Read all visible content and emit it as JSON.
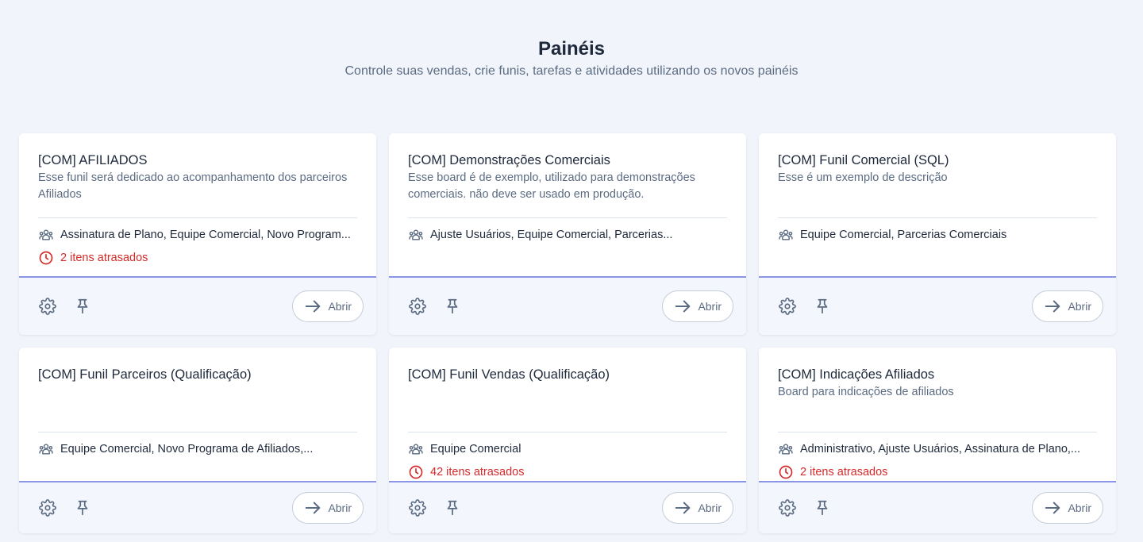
{
  "header": {
    "title": "Painéis",
    "subtitle": "Controle suas vendas, crie funis, tarefas e atividades utilizando os novos painéis"
  },
  "colors": {
    "accent": "#8b95e5",
    "overdue": "#d42a2a",
    "background": "#f1f5fb"
  },
  "icons": [
    "team-icon",
    "clock-icon",
    "gear-icon",
    "pin-icon",
    "arrow-right-icon"
  ],
  "open_label": "Abrir",
  "cards": [
    {
      "title": "[COM] AFILIADOS",
      "description": "Esse funil será dedicado ao acompanhamento dos parceiros Afiliados",
      "teams": "Assinatura de Plano, Equipe Comercial, Novo Program...",
      "overdue": "2 itens atrasados"
    },
    {
      "title": "[COM] Demonstrações Comerciais",
      "description": "Esse board é de exemplo, utilizado para demonstrações comerciais. não deve ser usado em produção.",
      "teams": "Ajuste Usuários, Equipe Comercial, Parcerias...",
      "overdue": ""
    },
    {
      "title": "[COM] Funil Comercial (SQL)",
      "description": "Esse é um exemplo de descrição",
      "teams": "Equipe Comercial, Parcerias Comerciais",
      "overdue": ""
    },
    {
      "title": "[COM] Funil Parceiros (Qualificação)",
      "description": "",
      "teams": "Equipe Comercial, Novo Programa de Afiliados,...",
      "overdue": ""
    },
    {
      "title": "[COM] Funil Vendas (Qualificação)",
      "description": "",
      "teams": "Equipe Comercial",
      "overdue": "42 itens atrasados"
    },
    {
      "title": "[COM] Indicações Afiliados",
      "description": "Board para indicações de afiliados",
      "teams": "Administrativo, Ajuste Usuários, Assinatura de Plano,...",
      "overdue": "2 itens atrasados"
    }
  ]
}
